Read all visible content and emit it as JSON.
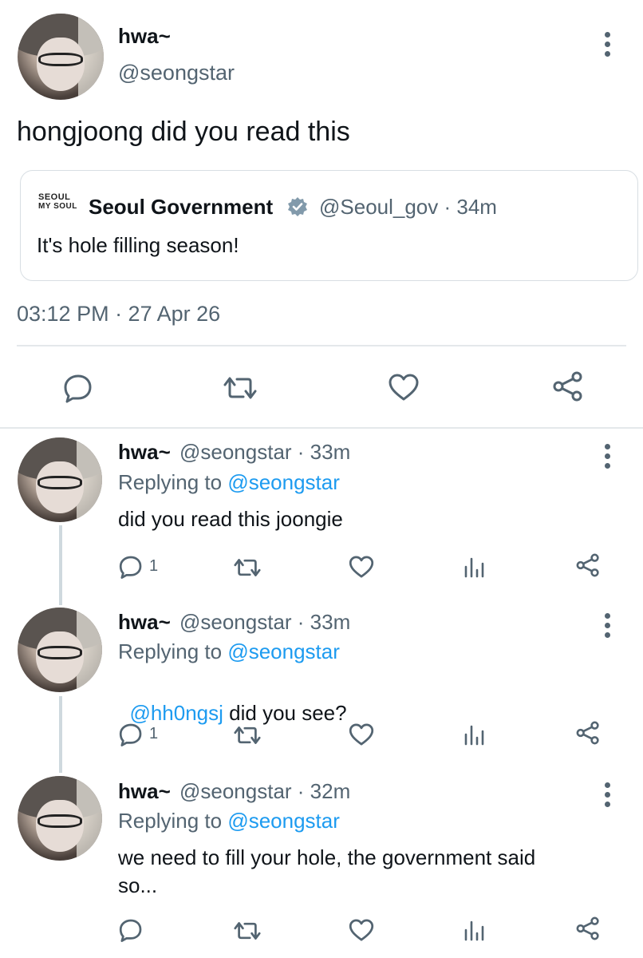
{
  "main_tweet": {
    "author_name": "hwa~",
    "author_handle": "@seongstar",
    "text": "hongjoong did you read this",
    "timestamp": "03:12 PM · 27 Apr 26",
    "quoted": {
      "logo_top": "SEOUL",
      "logo_bottom": "MY SOUL",
      "author_name": "Seoul Government",
      "handle_time": "@Seoul_gov · 34m",
      "text": "It's hole filling season!"
    },
    "actions": [
      "reply-icon",
      "retweet-icon",
      "like-icon",
      "share-icon"
    ]
  },
  "replies": [
    {
      "author_name": "hwa~",
      "handle_time": "@seongstar · 33m",
      "replying_prefix": "Replying to",
      "replying_to": "@seongstar",
      "mention": "",
      "text": "did you read this joongie",
      "reply_count": "1"
    },
    {
      "author_name": "hwa~",
      "handle_time": "@seongstar · 33m",
      "replying_prefix": "Replying to",
      "replying_to": "@seongstar",
      "mention": "@hh0ngsj",
      "text": " did you see?",
      "reply_count": "1"
    },
    {
      "author_name": "hwa~",
      "handle_time": "@seongstar · 32m",
      "replying_prefix": "Replying to",
      "replying_to": "@seongstar",
      "mention": "",
      "text_line1": "we need to fill your hole, the government said",
      "text_line2": "so...",
      "reply_count": ""
    }
  ],
  "colors": {
    "link": "#1d9bf0",
    "muted": "#536471",
    "verified": "#829aab"
  }
}
